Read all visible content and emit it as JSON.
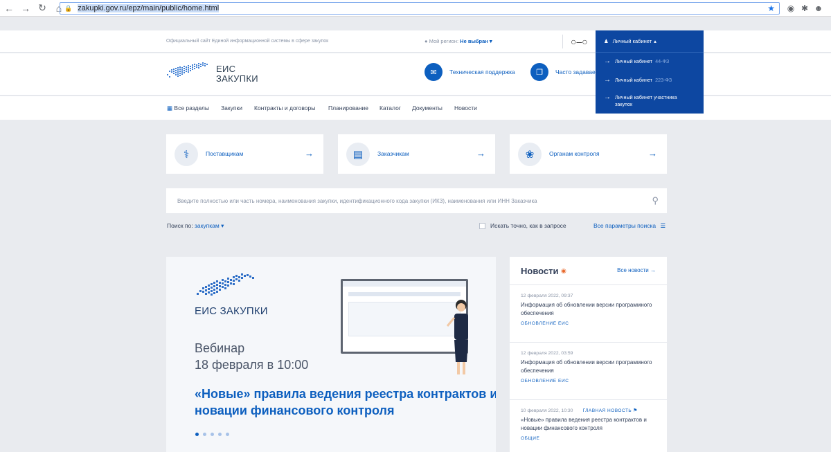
{
  "browser": {
    "url": "zakupki.gov.ru/epz/main/public/home.html"
  },
  "topbar": {
    "site_note": "Официальный сайт Единой информационной системы в сфере закупок",
    "region_label": "Мой регион:",
    "region_value": "Не выбран"
  },
  "cabinet": {
    "header": "Личный кабинет",
    "items": [
      {
        "label": "Личный кабинет",
        "law": "44-ФЗ"
      },
      {
        "label": "Личный кабинет",
        "law": "223-ФЗ"
      },
      {
        "label": "Личный кабинет участника закупок",
        "law": ""
      }
    ]
  },
  "header": {
    "logo_line1": "ЕИС",
    "logo_line2": "ЗАКУПКИ",
    "support_label": "Техническая поддержка",
    "faq_label": "Часто задаваем"
  },
  "menu": {
    "items": [
      "Все разделы",
      "Закупки",
      "Контракты и договоры",
      "Планирование",
      "Каталог",
      "Документы",
      "Новости"
    ]
  },
  "cards": [
    {
      "label": "Поставщикам"
    },
    {
      "label": "Заказчикам"
    },
    {
      "label": "Органам контроля"
    }
  ],
  "search": {
    "placeholder": "Введите полностью или часть номера, наименования закупки, идентификационного кода закупки (ИКЗ), наименования или ИНН Заказчика",
    "by_label": "Поиск по:",
    "by_value": "закупкам",
    "exact_label": "Искать точно, как в запросе",
    "all_params": "Все параметры поиска"
  },
  "banner": {
    "logo_text": "ЕИС ЗАКУПКИ",
    "webinar": "Вебинар",
    "date": "18 февраля в 10:00",
    "title": "«Новые» правила ведения реестра контрактов и новации финансового контроля"
  },
  "news": {
    "title": "Новости",
    "all": "Все новости",
    "items": [
      {
        "date": "12 февраля 2022, 09:37",
        "title": "Информация об обновлении версии программного обеспечения",
        "tag": "ОБНОВЛЕНИЕ ЕИС"
      },
      {
        "date": "12 февраля 2022, 03:59",
        "title": "Информация об обновлении версии программного обеспечения",
        "tag": "ОБНОВЛЕНИЕ ЕИС"
      },
      {
        "date": "10 февраля 2022, 10:30",
        "title": "«Новые» правила ведения реестра контрактов и новации финансового контроля",
        "tag": "ОБЩИЕ",
        "main_label": "ГЛАВНАЯ НОВОСТЬ"
      }
    ]
  },
  "colors": {
    "accent": "#0d5fbf",
    "cabinet_bg": "#0d47a1",
    "page_bg": "#e9ebef"
  }
}
